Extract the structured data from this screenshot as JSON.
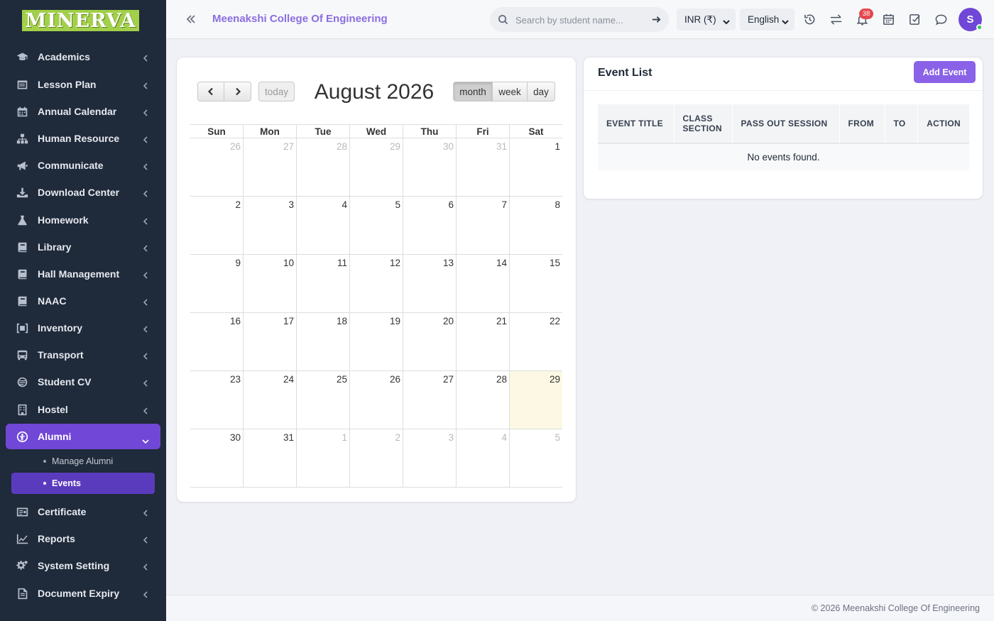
{
  "brand": {
    "logo_text": "MINERVA"
  },
  "sidebar": {
    "items": [
      {
        "label": "Academics",
        "icon": "graduation-cap-icon"
      },
      {
        "label": "Lesson Plan",
        "icon": "lesson-plan-icon"
      },
      {
        "label": "Annual Calendar",
        "icon": "calendar-icon"
      },
      {
        "label": "Human Resource",
        "icon": "sitemap-icon"
      },
      {
        "label": "Communicate",
        "icon": "megaphone-icon"
      },
      {
        "label": "Download Center",
        "icon": "download-icon"
      },
      {
        "label": "Homework",
        "icon": "flask-icon"
      },
      {
        "label": "Library",
        "icon": "book-icon"
      },
      {
        "label": "Hall Management",
        "icon": "book-icon"
      },
      {
        "label": "NAAC",
        "icon": "book-icon"
      },
      {
        "label": "Inventory",
        "icon": "inventory-icon"
      },
      {
        "label": "Transport",
        "icon": "bus-icon"
      },
      {
        "label": "Student CV",
        "icon": "cv-icon"
      },
      {
        "label": "Hostel",
        "icon": "building-icon"
      },
      {
        "label": "Alumni",
        "icon": "alumni-icon"
      },
      {
        "label": "Certificate",
        "icon": "certificate-icon"
      },
      {
        "label": "Reports",
        "icon": "line-chart-icon"
      },
      {
        "label": "System Setting",
        "icon": "gears-icon"
      },
      {
        "label": "Document Expiry",
        "icon": "document-icon"
      }
    ],
    "alumni_sub": [
      {
        "label": "Manage Alumni"
      },
      {
        "label": "Events"
      }
    ]
  },
  "header": {
    "college_name": "Meenakshi College Of Engineering",
    "search_placeholder": "Search by student name...",
    "currency": "INR (₹)",
    "language": "English",
    "notification_count": "38",
    "avatar_initial": "S"
  },
  "calendar": {
    "title": "August 2026",
    "today_label": "today",
    "view_month": "month",
    "view_week": "week",
    "view_day": "day",
    "days_of_week": [
      "Sun",
      "Mon",
      "Tue",
      "Wed",
      "Thu",
      "Fri",
      "Sat"
    ],
    "weeks": [
      [
        {
          "d": "26",
          "o": true
        },
        {
          "d": "27",
          "o": true
        },
        {
          "d": "28",
          "o": true
        },
        {
          "d": "29",
          "o": true
        },
        {
          "d": "30",
          "o": true
        },
        {
          "d": "31",
          "o": true
        },
        {
          "d": "1",
          "o": false
        }
      ],
      [
        {
          "d": "2",
          "o": false
        },
        {
          "d": "3",
          "o": false
        },
        {
          "d": "4",
          "o": false
        },
        {
          "d": "5",
          "o": false
        },
        {
          "d": "6",
          "o": false
        },
        {
          "d": "7",
          "o": false
        },
        {
          "d": "8",
          "o": false
        }
      ],
      [
        {
          "d": "9",
          "o": false
        },
        {
          "d": "10",
          "o": false
        },
        {
          "d": "11",
          "o": false
        },
        {
          "d": "12",
          "o": false
        },
        {
          "d": "13",
          "o": false
        },
        {
          "d": "14",
          "o": false
        },
        {
          "d": "15",
          "o": false
        }
      ],
      [
        {
          "d": "16",
          "o": false
        },
        {
          "d": "17",
          "o": false
        },
        {
          "d": "18",
          "o": false
        },
        {
          "d": "19",
          "o": false
        },
        {
          "d": "20",
          "o": false
        },
        {
          "d": "21",
          "o": false
        },
        {
          "d": "22",
          "o": false
        }
      ],
      [
        {
          "d": "23",
          "o": false
        },
        {
          "d": "24",
          "o": false
        },
        {
          "d": "25",
          "o": false
        },
        {
          "d": "26",
          "o": false
        },
        {
          "d": "27",
          "o": false
        },
        {
          "d": "28",
          "o": false
        },
        {
          "d": "29",
          "o": false,
          "today": true
        }
      ],
      [
        {
          "d": "30",
          "o": false
        },
        {
          "d": "31",
          "o": false
        },
        {
          "d": "1",
          "o": true
        },
        {
          "d": "2",
          "o": true
        },
        {
          "d": "3",
          "o": true
        },
        {
          "d": "4",
          "o": true
        },
        {
          "d": "5",
          "o": true
        }
      ]
    ]
  },
  "event_list": {
    "title": "Event List",
    "add_button": "Add Event",
    "columns": {
      "event_title": "EVENT TITLE",
      "class_section_1": "CLASS",
      "class_section_2": "SECTION",
      "pass_out_session": "PASS OUT SESSION",
      "from": "FROM",
      "to": "TO",
      "action": "ACTION"
    },
    "empty_message": "No events found."
  },
  "footer": {
    "copyright": "© 2026 Meenakshi College Of Engineering"
  },
  "colors": {
    "accent": "#7047d6",
    "sidebar_bg": "#1f2a3a",
    "today_bg": "#fcf8e3",
    "badge": "#e5484d"
  }
}
